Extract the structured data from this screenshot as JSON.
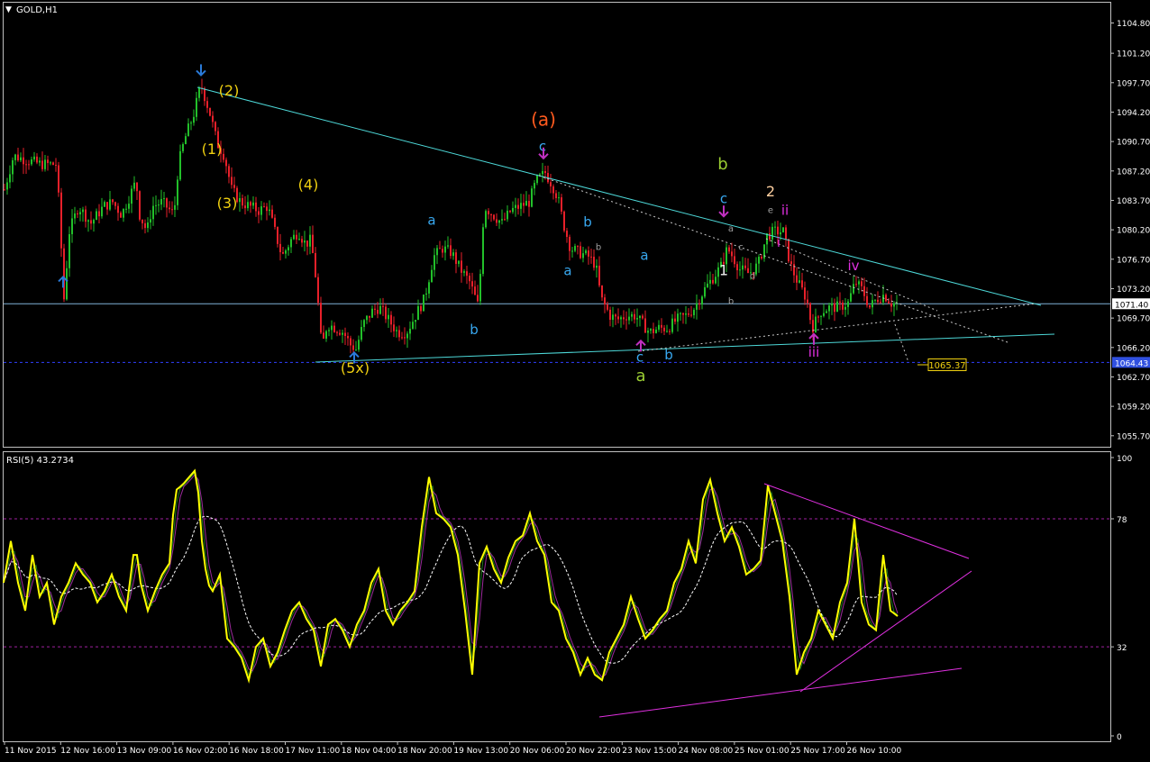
{
  "symbol_label": "GOLD,H1",
  "rsi_label": "RSI(5) 43.2734",
  "colors": {
    "background": "#000000",
    "frame": "#c0c0c0",
    "bull": "#22c02a",
    "bear": "#e8202a",
    "trend": "#4dd8d8",
    "rsi": "#ffff00",
    "rsi_trend": "#e030e0",
    "price_line": "#7fb2d8",
    "level_dash": "#3040ff"
  },
  "price_tags": [
    {
      "text": "1071.40",
      "price": 1071.4,
      "style": "current"
    },
    {
      "text": "1064.43",
      "price": 1064.43,
      "style": "blue"
    }
  ],
  "annotation_box": {
    "text": "1065.37",
    "price": 1065.37
  },
  "chart_data": [
    {
      "type": "candlestick",
      "title": "GOLD,H1",
      "ylim": [
        1054.5,
        1107.0
      ],
      "y_ticks": [
        "1104.80",
        "1101.20",
        "1097.70",
        "1094.20",
        "1090.70",
        "1087.20",
        "1083.70",
        "1080.20",
        "1076.70",
        "1073.20",
        "1069.70",
        "1066.20",
        "1062.70",
        "1059.20",
        "1055.70"
      ],
      "x_ticks": [
        "11 Nov 2015",
        "12 Nov 16:00",
        "13 Nov 09:00",
        "16 Nov 02:00",
        "16 Nov 18:00",
        "17 Nov 11:00",
        "18 Nov 04:00",
        "18 Nov 20:00",
        "19 Nov 13:00",
        "20 Nov 06:00",
        "20 Nov 22:00",
        "23 Nov 15:00",
        "24 Nov 08:00",
        "25 Nov 01:00",
        "25 Nov 17:00",
        "26 Nov 10:00"
      ],
      "close_path": [
        [
          0,
          1085
        ],
        [
          10,
          1089
        ],
        [
          25,
          1088.5
        ],
        [
          40,
          1088
        ],
        [
          58,
          1088
        ],
        [
          66,
          1072
        ],
        [
          72,
          1080
        ],
        [
          82,
          1083
        ],
        [
          96,
          1081
        ],
        [
          110,
          1083
        ],
        [
          120,
          1083.5
        ],
        [
          130,
          1082
        ],
        [
          146,
          1086
        ],
        [
          150,
          1082
        ],
        [
          158,
          1080
        ],
        [
          164,
          1083
        ],
        [
          175,
          1083.5
        ],
        [
          188,
          1082
        ],
        [
          193,
          1088
        ],
        [
          200,
          1091
        ],
        [
          210,
          1094
        ],
        [
          218,
          1097.5
        ],
        [
          228,
          1094
        ],
        [
          236,
          1090.5
        ],
        [
          244,
          1089
        ],
        [
          252,
          1085
        ],
        [
          262,
          1083.5
        ],
        [
          272,
          1083
        ],
        [
          282,
          1082.5
        ],
        [
          292,
          1083
        ],
        [
          300,
          1080
        ],
        [
          308,
          1077
        ],
        [
          318,
          1079
        ],
        [
          326,
          1080
        ],
        [
          334,
          1078.5
        ],
        [
          340,
          1079
        ],
        [
          346,
          1074
        ],
        [
          352,
          1066
        ],
        [
          358,
          1069
        ],
        [
          368,
          1068.5
        ],
        [
          376,
          1068
        ],
        [
          384,
          1066.5
        ],
        [
          390,
          1066
        ],
        [
          398,
          1069
        ],
        [
          408,
          1070.5
        ],
        [
          416,
          1071
        ],
        [
          426,
          1069.5
        ],
        [
          436,
          1068
        ],
        [
          446,
          1068
        ],
        [
          456,
          1070
        ],
        [
          466,
          1072
        ],
        [
          476,
          1077
        ],
        [
          486,
          1078
        ],
        [
          496,
          1077.5
        ],
        [
          506,
          1075.5
        ],
        [
          516,
          1074
        ],
        [
          526,
          1071
        ],
        [
          532,
          1083
        ],
        [
          542,
          1082
        ],
        [
          552,
          1081
        ],
        [
          562,
          1082.5
        ],
        [
          572,
          1083
        ],
        [
          582,
          1083.5
        ],
        [
          590,
          1086
        ],
        [
          600,
          1087
        ],
        [
          608,
          1085.5
        ],
        [
          614,
          1084
        ],
        [
          620,
          1081
        ],
        [
          628,
          1078
        ],
        [
          638,
          1077.5
        ],
        [
          648,
          1077
        ],
        [
          656,
          1076
        ],
        [
          662,
          1072
        ],
        [
          672,
          1070
        ],
        [
          680,
          1069.5
        ],
        [
          690,
          1070
        ],
        [
          700,
          1070
        ],
        [
          708,
          1069
        ],
        [
          716,
          1068
        ],
        [
          726,
          1068.5
        ],
        [
          736,
          1068.5
        ],
        [
          746,
          1069.5
        ],
        [
          756,
          1070
        ],
        [
          766,
          1071
        ],
        [
          776,
          1073
        ],
        [
          786,
          1074.5
        ],
        [
          796,
          1076
        ],
        [
          802,
          1078
        ],
        [
          808,
          1077
        ],
        [
          816,
          1075.5
        ],
        [
          826,
          1075
        ],
        [
          836,
          1076
        ],
        [
          846,
          1079.5
        ],
        [
          854,
          1080
        ],
        [
          864,
          1080
        ],
        [
          872,
          1076
        ],
        [
          880,
          1074
        ],
        [
          890,
          1072
        ],
        [
          896,
          1068.5
        ],
        [
          906,
          1070.5
        ],
        [
          916,
          1071
        ],
        [
          926,
          1071
        ],
        [
          936,
          1071.5
        ],
        [
          944,
          1074
        ],
        [
          952,
          1073
        ],
        [
          960,
          1071
        ],
        [
          968,
          1072
        ],
        [
          976,
          1072.5
        ],
        [
          984,
          1071.5
        ],
        [
          992,
          1071.4
        ]
      ]
    },
    {
      "type": "line",
      "title": "RSI(5) 43.2734",
      "ylim": [
        0,
        100
      ],
      "y_ticks": [
        "100",
        "78",
        "32",
        "0"
      ],
      "levels": [
        78,
        32
      ],
      "series": [
        {
          "values_path": [
            [
              0,
              55
            ],
            [
              8,
              70
            ],
            [
              16,
              55
            ],
            [
              24,
              45
            ],
            [
              32,
              65
            ],
            [
              40,
              50
            ],
            [
              48,
              55
            ],
            [
              56,
              40
            ],
            [
              64,
              50
            ],
            [
              72,
              55
            ],
            [
              80,
              62
            ],
            [
              88,
              58
            ],
            [
              96,
              55
            ],
            [
              104,
              48
            ],
            [
              112,
              52
            ],
            [
              120,
              58
            ],
            [
              128,
              50
            ],
            [
              136,
              45
            ],
            [
              146,
              70
            ],
            [
              152,
              55
            ],
            [
              160,
              45
            ],
            [
              168,
              52
            ],
            [
              176,
              58
            ],
            [
              184,
              62
            ],
            [
              190,
              88
            ],
            [
              198,
              90
            ],
            [
              206,
              93
            ],
            [
              214,
              96
            ],
            [
              220,
              70
            ],
            [
              226,
              55
            ],
            [
              232,
              52
            ],
            [
              240,
              58
            ],
            [
              248,
              35
            ],
            [
              256,
              32
            ],
            [
              264,
              28
            ],
            [
              272,
              20
            ],
            [
              280,
              32
            ],
            [
              288,
              35
            ],
            [
              296,
              25
            ],
            [
              304,
              30
            ],
            [
              312,
              38
            ],
            [
              320,
              45
            ],
            [
              328,
              48
            ],
            [
              336,
              42
            ],
            [
              344,
              38
            ],
            [
              352,
              25
            ],
            [
              360,
              40
            ],
            [
              368,
              42
            ],
            [
              376,
              38
            ],
            [
              384,
              32
            ],
            [
              392,
              40
            ],
            [
              400,
              45
            ],
            [
              408,
              55
            ],
            [
              416,
              60
            ],
            [
              424,
              45
            ],
            [
              432,
              40
            ],
            [
              440,
              45
            ],
            [
              448,
              48
            ],
            [
              456,
              52
            ],
            [
              464,
              75
            ],
            [
              472,
              93
            ],
            [
              480,
              80
            ],
            [
              488,
              78
            ],
            [
              496,
              75
            ],
            [
              504,
              65
            ],
            [
              512,
              45
            ],
            [
              520,
              22
            ],
            [
              528,
              62
            ],
            [
              536,
              68
            ],
            [
              544,
              60
            ],
            [
              552,
              55
            ],
            [
              560,
              64
            ],
            [
              568,
              70
            ],
            [
              576,
              72
            ],
            [
              584,
              80
            ],
            [
              592,
              70
            ],
            [
              600,
              65
            ],
            [
              608,
              48
            ],
            [
              616,
              45
            ],
            [
              624,
              35
            ],
            [
              632,
              30
            ],
            [
              640,
              22
            ],
            [
              648,
              28
            ],
            [
              656,
              22
            ],
            [
              664,
              20
            ],
            [
              672,
              30
            ],
            [
              680,
              35
            ],
            [
              688,
              40
            ],
            [
              696,
              50
            ],
            [
              704,
              42
            ],
            [
              712,
              35
            ],
            [
              720,
              38
            ],
            [
              728,
              42
            ],
            [
              736,
              45
            ],
            [
              744,
              55
            ],
            [
              752,
              60
            ],
            [
              760,
              70
            ],
            [
              768,
              62
            ],
            [
              776,
              85
            ],
            [
              784,
              92
            ],
            [
              792,
              80
            ],
            [
              800,
              70
            ],
            [
              808,
              75
            ],
            [
              816,
              68
            ],
            [
              824,
              58
            ],
            [
              832,
              60
            ],
            [
              840,
              63
            ],
            [
              848,
              90
            ],
            [
              856,
              80
            ],
            [
              864,
              70
            ],
            [
              872,
              50
            ],
            [
              880,
              22
            ],
            [
              888,
              30
            ],
            [
              896,
              35
            ],
            [
              904,
              45
            ],
            [
              912,
              40
            ],
            [
              920,
              35
            ],
            [
              928,
              48
            ],
            [
              936,
              55
            ],
            [
              944,
              78
            ],
            [
              952,
              48
            ],
            [
              960,
              40
            ],
            [
              968,
              38
            ],
            [
              976,
              65
            ],
            [
              984,
              45
            ],
            [
              992,
              43
            ]
          ]
        }
      ]
    }
  ],
  "wave_labels": [
    {
      "text": "(2)",
      "bar": 250,
      "price": 1096.2,
      "color": "#f0d010",
      "size": 16
    },
    {
      "text": "(1)",
      "bar": 231,
      "price": 1089.2,
      "color": "#f0d010",
      "size": 16
    },
    {
      "text": "(3)",
      "bar": 248,
      "price": 1082.8,
      "color": "#f0d010",
      "size": 16
    },
    {
      "text": "(4)",
      "bar": 338,
      "price": 1085.0,
      "color": "#f0d010",
      "size": 16
    },
    {
      "text": "(5x)",
      "bar": 390,
      "price": 1063.2,
      "color": "#f0d010",
      "size": 16
    },
    {
      "text": "(a)",
      "bar": 599,
      "price": 1092.6,
      "color": "#ff5a1e",
      "size": 20
    },
    {
      "text": "c",
      "bar": 598,
      "price": 1089.6,
      "color": "#38a8f0",
      "size": 15
    },
    {
      "text": "a",
      "bar": 475,
      "price": 1080.8,
      "color": "#38a8f0",
      "size": 15
    },
    {
      "text": "b",
      "bar": 522,
      "price": 1067.8,
      "color": "#38a8f0",
      "size": 15
    },
    {
      "text": "b",
      "bar": 648,
      "price": 1080.6,
      "color": "#38a8f0",
      "size": 15
    },
    {
      "text": "a",
      "bar": 626,
      "price": 1074.8,
      "color": "#38a8f0",
      "size": 15
    },
    {
      "text": "a",
      "bar": 711,
      "price": 1076.6,
      "color": "#38a8f0",
      "size": 15
    },
    {
      "text": "c",
      "bar": 706,
      "price": 1064.5,
      "color": "#38a8f0",
      "size": 15
    },
    {
      "text": "b",
      "bar": 738,
      "price": 1064.8,
      "color": "#38a8f0",
      "size": 15
    },
    {
      "text": "a",
      "bar": 707,
      "price": 1062.2,
      "color": "#9acd32",
      "size": 18
    },
    {
      "text": "b",
      "bar": 798,
      "price": 1087.4,
      "color": "#9acd32",
      "size": 18
    },
    {
      "text": "c",
      "bar": 799,
      "price": 1083.4,
      "color": "#38a8f0",
      "size": 15
    },
    {
      "text": "1",
      "bar": 799,
      "price": 1074.8,
      "color": "#f0f0f0",
      "size": 16
    },
    {
      "text": "2",
      "bar": 851,
      "price": 1084.2,
      "color": "#ffd0a0",
      "size": 16
    },
    {
      "text": "ii",
      "bar": 867,
      "price": 1082.0,
      "color": "#e030e0",
      "size": 15
    },
    {
      "text": "i",
      "bar": 860,
      "price": 1078.2,
      "color": "#e030e0",
      "size": 14
    },
    {
      "text": "iv",
      "bar": 943,
      "price": 1075.4,
      "color": "#e030e0",
      "size": 15
    },
    {
      "text": "iii",
      "bar": 899,
      "price": 1065.1,
      "color": "#e030e0",
      "size": 15
    },
    {
      "text": "a",
      "bar": 807,
      "price": 1080.0,
      "color": "#a0a0a0",
      "size": 10
    },
    {
      "text": "b",
      "bar": 807,
      "price": 1071.4,
      "color": "#a0a0a0",
      "size": 10
    },
    {
      "text": "c",
      "bar": 818,
      "price": 1077.8,
      "color": "#a0a0a0",
      "size": 10
    },
    {
      "text": "d",
      "bar": 831,
      "price": 1074.4,
      "color": "#a0a0a0",
      "size": 10
    },
    {
      "text": "e",
      "bar": 851,
      "price": 1082.2,
      "color": "#a0a0a0",
      "size": 10
    },
    {
      "text": "b",
      "bar": 660,
      "price": 1077.8,
      "color": "#a0a0a0",
      "size": 10
    }
  ],
  "arrows": [
    {
      "bar": 219,
      "price": 1098.6,
      "dir": "down",
      "color": "#2a7ad8"
    },
    {
      "bar": 66,
      "price": 1074.6,
      "dir": "up",
      "color": "#2a7ad8"
    },
    {
      "bar": 389,
      "price": 1065.6,
      "dir": "up",
      "color": "#2a7ad8"
    },
    {
      "bar": 599,
      "price": 1088.7,
      "dir": "down",
      "color": "#c030c0"
    },
    {
      "bar": 707,
      "price": 1067.0,
      "dir": "up",
      "color": "#c030c0"
    },
    {
      "bar": 799,
      "price": 1081.8,
      "dir": "down",
      "color": "#c030c0"
    },
    {
      "bar": 899,
      "price": 1067.8,
      "dir": "up",
      "color": "#c030c0"
    }
  ]
}
